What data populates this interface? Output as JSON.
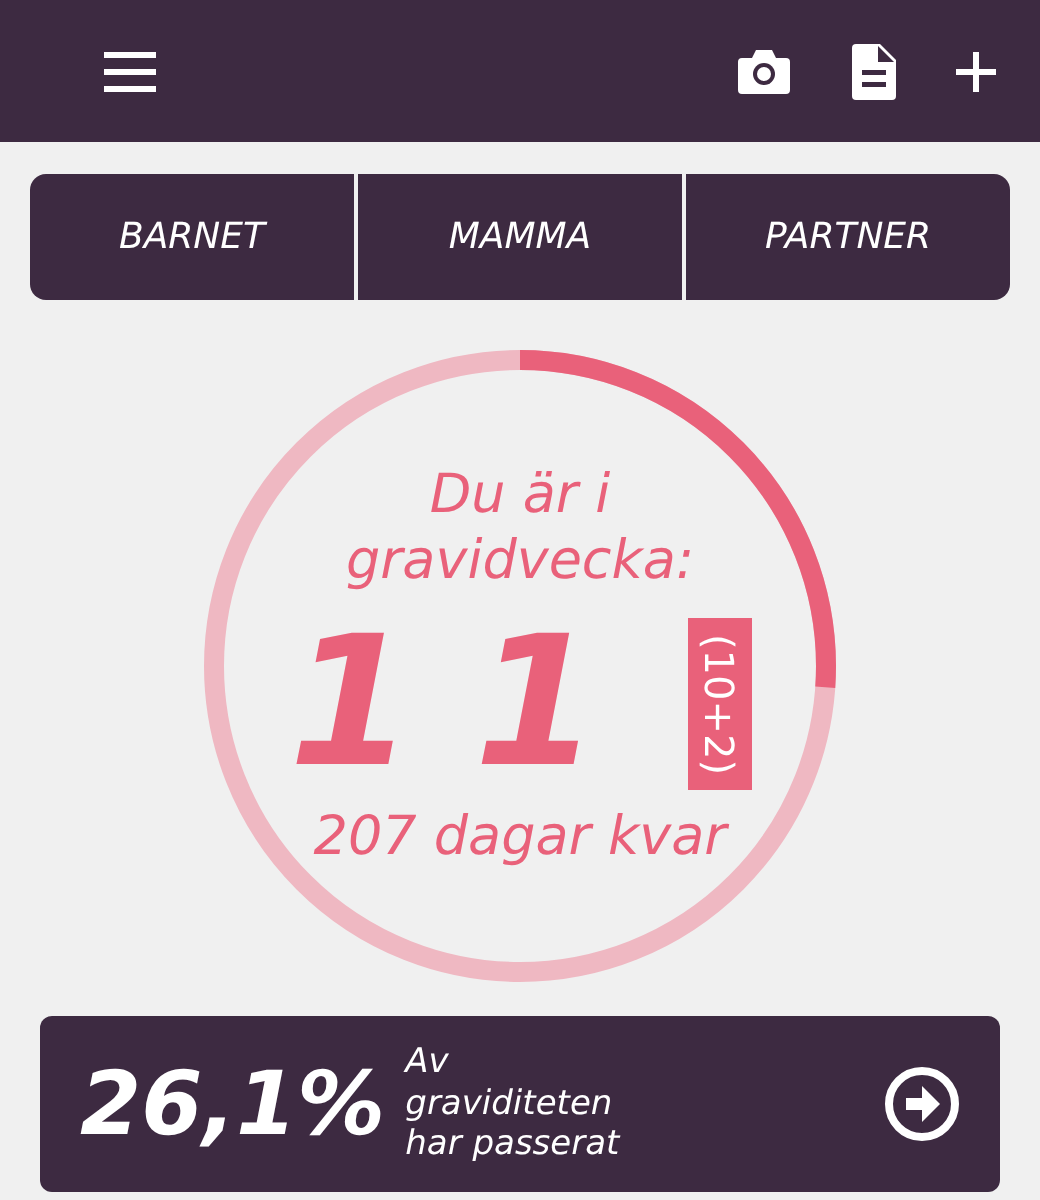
{
  "tabs": [
    {
      "label": "BARNET"
    },
    {
      "label": "MAMMA"
    },
    {
      "label": "PARTNER"
    }
  ],
  "progress": {
    "level": 0.261,
    "heading": "Du är i gravidvecka:",
    "week": "11",
    "extra": "(10+2)",
    "remaining": "207 dagar kvar"
  },
  "summary": {
    "percent": "26,1%",
    "caption": "Av graviditeten har passerat"
  }
}
